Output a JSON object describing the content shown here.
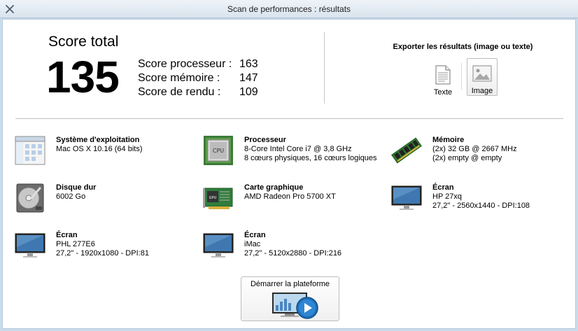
{
  "window": {
    "title": "Scan de performances : résultats"
  },
  "score": {
    "label": "Score total",
    "value": "135",
    "sub": [
      {
        "label": "Score processeur :",
        "value": "163"
      },
      {
        "label": "Score mémoire :",
        "value": "147"
      },
      {
        "label": "Score de rendu :",
        "value": "109"
      }
    ]
  },
  "export": {
    "title": "Exporter les résultats (image ou texte)",
    "text_label": "Texte",
    "image_label": "Image"
  },
  "hardware": {
    "os": {
      "name": "Système d'exploitation",
      "line1": "Mac OS X 10.16 (64 bits)",
      "line2": ""
    },
    "cpu": {
      "name": "Processeur",
      "line1": "8-Core Intel Core i7 @ 3,8 GHz",
      "line2": "8 cœurs physiques, 16 cœurs logiques",
      "chip_label": "CPU"
    },
    "memory": {
      "name": "Mémoire",
      "line1": "(2x) 32 GB @ 2667 MHz",
      "line2": "(2x) empty @ empty"
    },
    "disk": {
      "name": "Disque dur",
      "line1": "6002 Go",
      "line2": ""
    },
    "gpu": {
      "name": "Carte graphique",
      "line1": "AMD Radeon Pro 5700 XT",
      "line2": "",
      "chip_label": "GPU"
    },
    "screen1": {
      "name": "Écran",
      "line1": "HP 27xq",
      "line2": "27,2\" - 2560x1440 - DPI:108"
    },
    "screen2": {
      "name": "Écran",
      "line1": "PHL 277E6",
      "line2": "27,2\" - 1920x1080 - DPI:81"
    },
    "screen3": {
      "name": "Écran",
      "line1": "iMac",
      "line2": "27,2\" - 5120x2880 - DPI:216"
    }
  },
  "launch": {
    "label": "Démarrer la plateforme"
  },
  "colors": {
    "window_bg": "#c9dced",
    "accent_blue": "#1f6fb5"
  }
}
